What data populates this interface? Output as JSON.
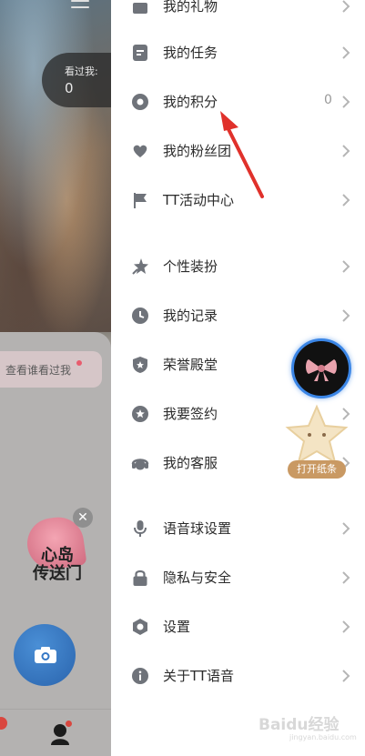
{
  "background": {
    "seen_label": "看过我:",
    "seen_value": "0",
    "who_viewed": "查看谁看过我",
    "island_text_1": "心岛",
    "island_text_2": "传送门",
    "close_glyph": "✕"
  },
  "drawer": {
    "items": [
      {
        "label": "我的礼物",
        "icon": "gift-icon"
      },
      {
        "label": "我的任务",
        "icon": "task-icon"
      },
      {
        "label": "我的积分",
        "icon": "points-icon",
        "value": "0"
      },
      {
        "label": "我的粉丝团",
        "icon": "fan-club-icon"
      },
      {
        "label": "TT活动中心",
        "icon": "flag-icon"
      },
      {
        "label": "个性装扮",
        "icon": "decoration-icon"
      },
      {
        "label": "我的记录",
        "icon": "clock-icon"
      },
      {
        "label": "荣誉殿堂",
        "icon": "shield-icon"
      },
      {
        "label": "我要签约",
        "icon": "star-badge-icon"
      },
      {
        "label": "我的客服",
        "icon": "customer-service-icon"
      },
      {
        "label": "语音球设置",
        "icon": "microphone-icon"
      },
      {
        "label": "隐私与安全",
        "icon": "lock-icon"
      },
      {
        "label": "设置",
        "icon": "gear-icon"
      },
      {
        "label": "关于TT语音",
        "icon": "info-icon"
      }
    ]
  },
  "floating": {
    "star_label": "打开纸条"
  },
  "watermark": {
    "text": "Baidu经验",
    "sub": "jingyan.baidu.com"
  },
  "colors": {
    "icon": "#6f737a",
    "chevron": "#b5b5b5",
    "accent_red": "#e0312b",
    "camera_blue": "#3478c6"
  }
}
